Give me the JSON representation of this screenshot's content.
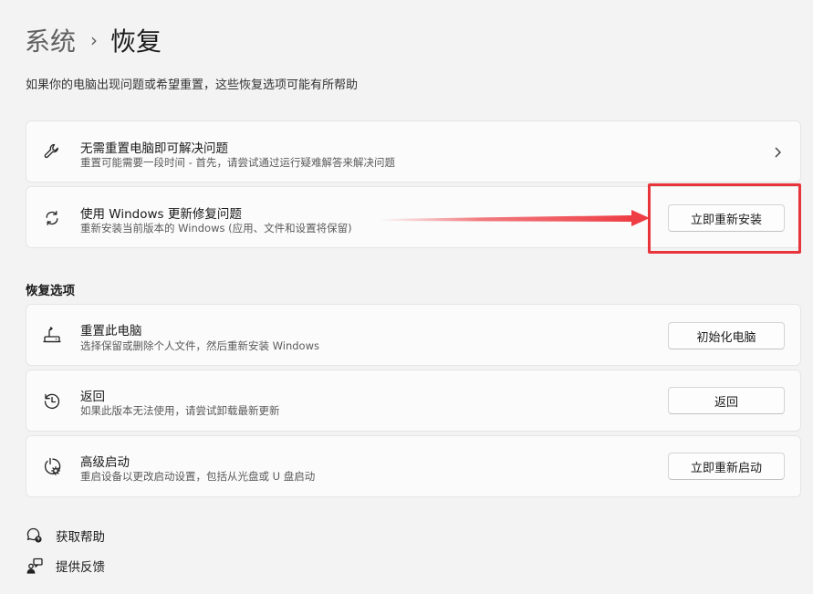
{
  "breadcrumb": {
    "parent": "系统",
    "separator": "›",
    "current": "恢复"
  },
  "subtitle": "如果你的电脑出现问题或希望重置，这些恢复选项可能有所帮助",
  "cards": {
    "troubleshoot": {
      "title": "无需重置电脑即可解决问题",
      "desc": "重置可能需要一段时间 - 首先，请尝试通过运行疑难解答来解决问题",
      "icon": "wrench-icon"
    },
    "windows_update": {
      "title": "使用 Windows 更新修复问题",
      "desc": "重新安装当前版本的 Windows (应用、文件和设置将保留)",
      "button": "立即重新安装",
      "icon": "sync-icon"
    }
  },
  "section_heading": "恢复选项",
  "recovery_options": {
    "reset": {
      "title": "重置此电脑",
      "desc": "选择保留或删除个人文件，然后重新安装 Windows",
      "button": "初始化电脑",
      "icon": "reset-pc-icon"
    },
    "go_back": {
      "title": "返回",
      "desc": "如果此版本无法使用，请尝试卸载最新更新",
      "button": "返回",
      "icon": "history-icon"
    },
    "advanced_startup": {
      "title": "高级启动",
      "desc": "重启设备以更改启动设置，包括从光盘或 U 盘启动",
      "button": "立即重新启动",
      "icon": "advanced-startup-icon"
    }
  },
  "footer": {
    "help": {
      "label": "获取帮助",
      "icon": "help-icon"
    },
    "feedback": {
      "label": "提供反馈",
      "icon": "feedback-icon"
    }
  },
  "colors": {
    "background": "#f3f3f3",
    "card": "#fbfbfb",
    "annotation": "#e8343b"
  }
}
